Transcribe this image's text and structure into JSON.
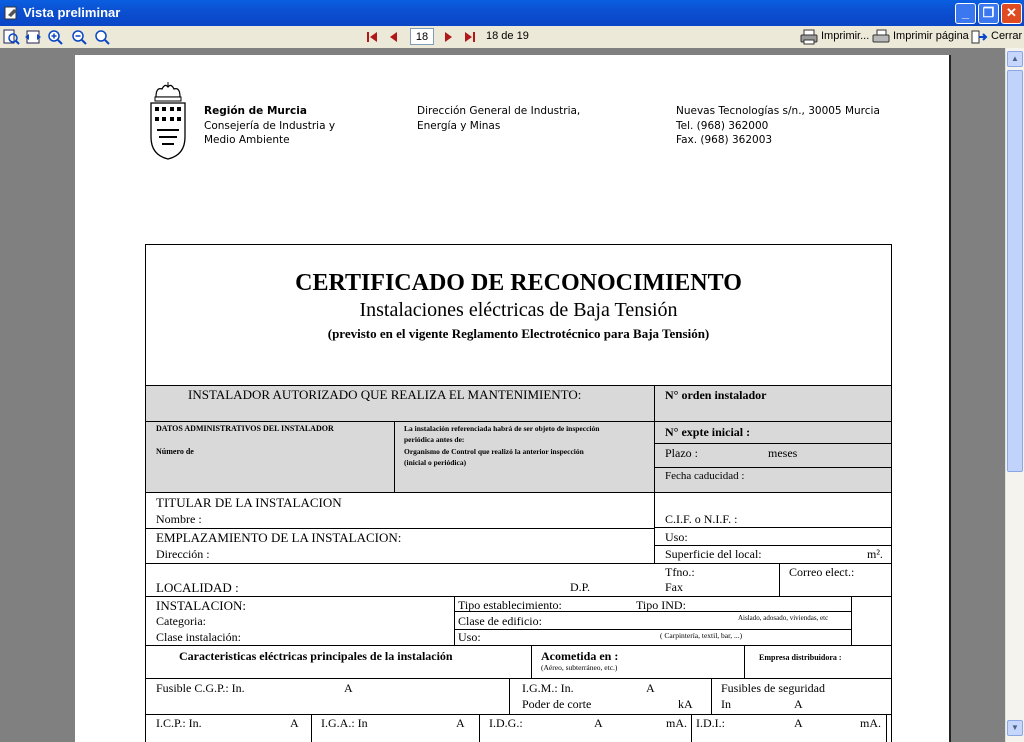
{
  "window": {
    "title": "Vista preliminar",
    "minimize": "_",
    "maximize": "❐",
    "close": "✕"
  },
  "toolbar": {
    "page_input": "18",
    "page_info": "18 de 19",
    "print_label": "Imprimir...",
    "print_page_label": "Imprimir página",
    "close_label": "Cerrar"
  },
  "header": {
    "region_name": "Región de Murcia",
    "region_line2": "Consejería de Industria y",
    "region_line3": "Medio Ambiente",
    "direccion_line1": "Dirección General de Industria,",
    "direccion_line2": "Energía y Minas",
    "address": "Nuevas Tecnologías s/n., 30005 Murcia",
    "tel": "Tel. (968) 362000",
    "fax": "Fax. (968) 362003"
  },
  "certificate": {
    "title": "CERTIFICADO DE RECONOCIMIENTO",
    "subtitle": "Instalaciones eléctricas de Baja Tensión",
    "note": "(previsto en el vigente Reglamento Electrotécnico para Baja Tensión)",
    "instalador_header": "INSTALADOR AUTORIZADO QUE REALIZA EL MANTENIMIENTO:",
    "orden_instalador": "N° orden instalador",
    "datos_admin": "DATOS ADMINISTRATIVOS DEL INSTALADOR",
    "numero_de": "Número de",
    "instalacion_note_1": "La instalación referenciada habrá de ser objeto de inspección",
    "instalacion_note_2": "periódica antes de:",
    "instalacion_note_3": "Organismo de Control que realizó la anterior inspección",
    "instalacion_note_4": "(inicial o periódica)",
    "expte_inicial": "N° expte inicial :",
    "plazo": "Plazo :",
    "meses": "meses",
    "fecha_caducidad": "Fecha caducidad :",
    "titular_header": "TITULAR DE LA INSTALACION",
    "nombre": "Nombre :",
    "cif": "C.I.F. o N.I.F. :",
    "emplazamiento_header": "EMPLAZAMIENTO DE LA INSTALACION:",
    "direccion": "Dirección :",
    "uso": "Uso:",
    "superficie": "Superficie del local:",
    "m2": "m².",
    "localidad": "LOCALIDAD :",
    "dp": "D.P.",
    "tfno": "Tfno.:",
    "fax": "Fax",
    "correo": "Correo elect.:",
    "instalacion_header": "INSTALACION:",
    "categoria": "Categoria:",
    "clase_instalacion": "Clase instalación:",
    "tipo_establecimiento": "Tipo establecimiento:",
    "tipo_ind": "Tipo IND:",
    "aislado_note": "Aislado, adosado, viviendas, etc",
    "clase_edificio": "Clase de edificio:",
    "uso2": "Uso:",
    "uso_note": "( Carpintería, textil, bar, ...)",
    "caracteristicas": "Caracteristicas eléctricas principales de la instalación",
    "acometida": "Acometida en :",
    "acometida_note": "(Aéreo, subterráneo, etc.)",
    "empresa_distribuidora": "Empresa distribuidora :",
    "fusible_cgp": "Fusible C.G.P.: In.",
    "unit_a": "A",
    "igm": "I.G.M.: In.",
    "poder_corte": "Poder de corte",
    "unit_ka": "kA",
    "fusibles_seguridad": "Fusibles de seguridad",
    "in_label": "In",
    "icp": "I.C.P.: In.",
    "iga": "I.G.A.: In",
    "idg": "I.D.G.:",
    "idi": "I.D.I.:",
    "unit_ma": "mA."
  }
}
